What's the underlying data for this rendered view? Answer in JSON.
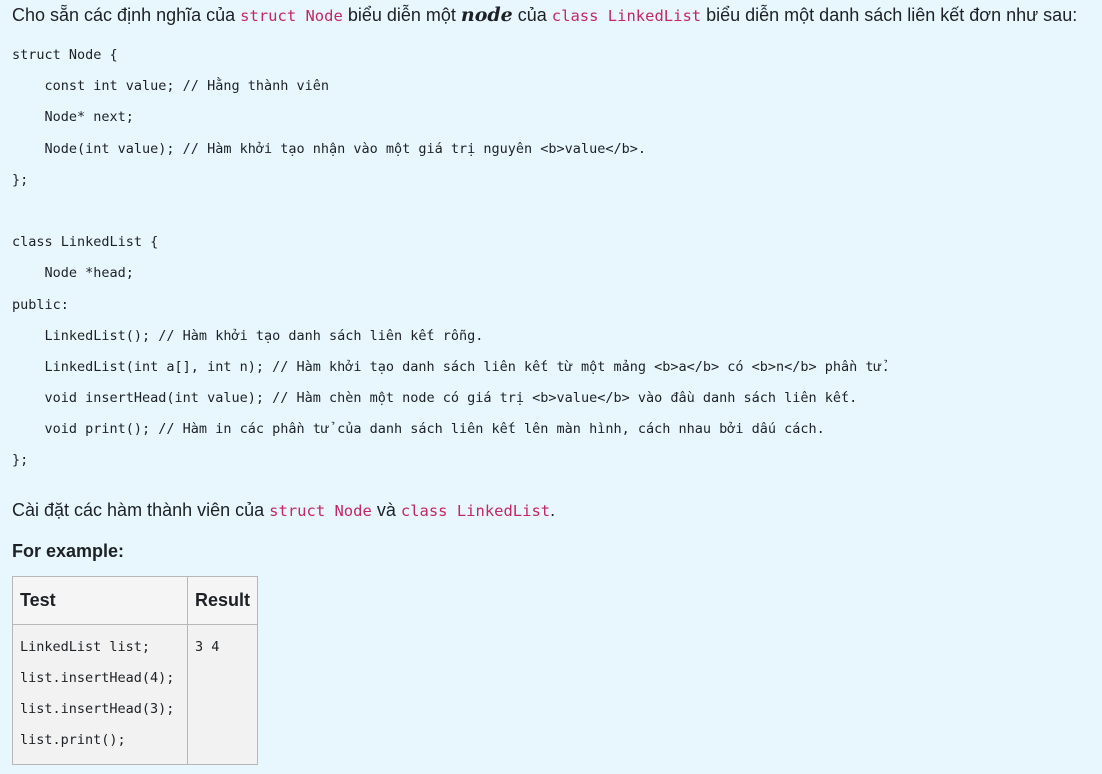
{
  "intro": {
    "prefix": "Cho sẵn các định nghĩa của ",
    "code1": "struct Node",
    "mid1": " biểu diễn một ",
    "em": "node",
    "mid2": " của ",
    "code2": "class LinkedList",
    "suffix": " biểu diễn một danh sách liên kết đơn như sau:"
  },
  "code_lines": [
    "struct Node {",
    "    const int value; // Hằng thành viên",
    "    Node* next;",
    "    Node(int value); // Hàm khởi tạo nhận vào một giá trị nguyên <b>value</b>.",
    "};",
    "",
    "class LinkedList {",
    "    Node *head;",
    "public:",
    "    LinkedList(); // Hàm khởi tạo danh sách liên kết rỗng.",
    "    LinkedList(int a[], int n); // Hàm khởi tạo danh sách liên kết từ một mảng <b>a</b> có <b>n</b> phần tử.",
    "    void insertHead(int value); // Hàm chèn một node có giá trị <b>value</b> vào đầu danh sách liên kết.",
    "    void print(); // Hàm in các phần tử của danh sách liên kết lên màn hình, cách nhau bởi dấu cách.",
    "};"
  ],
  "instruction": {
    "prefix": "Cài đặt các hàm thành viên của ",
    "code1": "struct Node",
    "mid": " và ",
    "code2": "class LinkedList",
    "suffix": "."
  },
  "for_example": "For example:",
  "table": {
    "headers": [
      "Test",
      "Result"
    ],
    "test_lines": [
      "LinkedList list;",
      "list.insertHead(4);",
      "list.insertHead(3);",
      "list.print();"
    ],
    "result": "3 4"
  }
}
